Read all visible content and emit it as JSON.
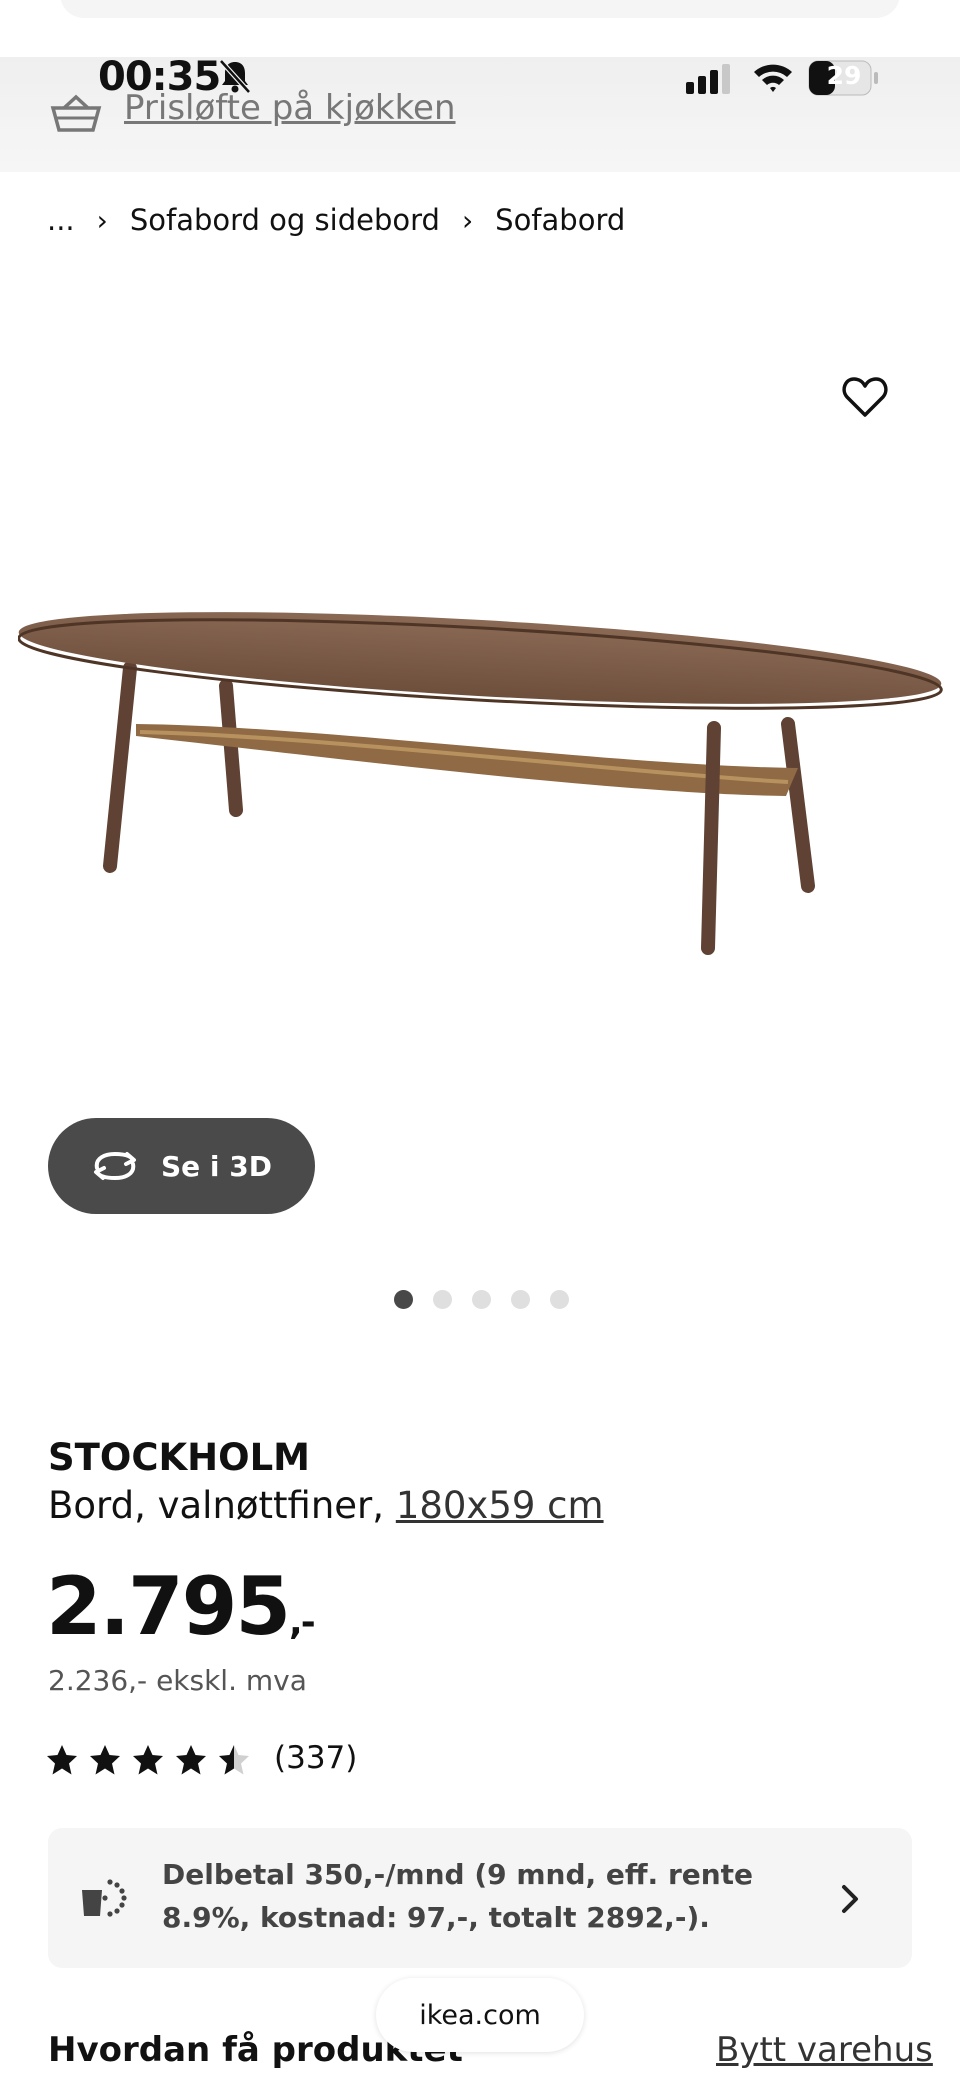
{
  "status_bar": {
    "time": "00:35",
    "battery": "29"
  },
  "promo": {
    "link_text": "Prisløfte på kjøkken"
  },
  "breadcrumb": {
    "ellipsis": "...",
    "items": [
      "Sofabord og sidebord",
      "Sofabord"
    ]
  },
  "product": {
    "view_3d_label": "Se i 3D",
    "image_count": 5,
    "active_image": 1,
    "name": "STOCKHOLM",
    "description": "Bord, valnøttfiner,",
    "size": "180x59 cm",
    "price": "2.795",
    "price_suffix": ",-",
    "price_ex_vat": "2.236,- ekskl. mva",
    "rating": 4.5,
    "reviews": "(337)"
  },
  "finance": {
    "text": "Delbetal 350,-/mnd (9 mnd, eff. rente 8.9%, kostnad: 97,-, totalt 2892,-)."
  },
  "browser": {
    "url": "ikea.com"
  },
  "delivery": {
    "title": "Hvordan få produktet",
    "change_store": "Bytt varehus"
  },
  "colors": {
    "button_dark": "#4a4a4a",
    "box_bg": "#f5f5f5",
    "dot_active": "#484848",
    "dot_inactive": "#dfdfdf"
  }
}
